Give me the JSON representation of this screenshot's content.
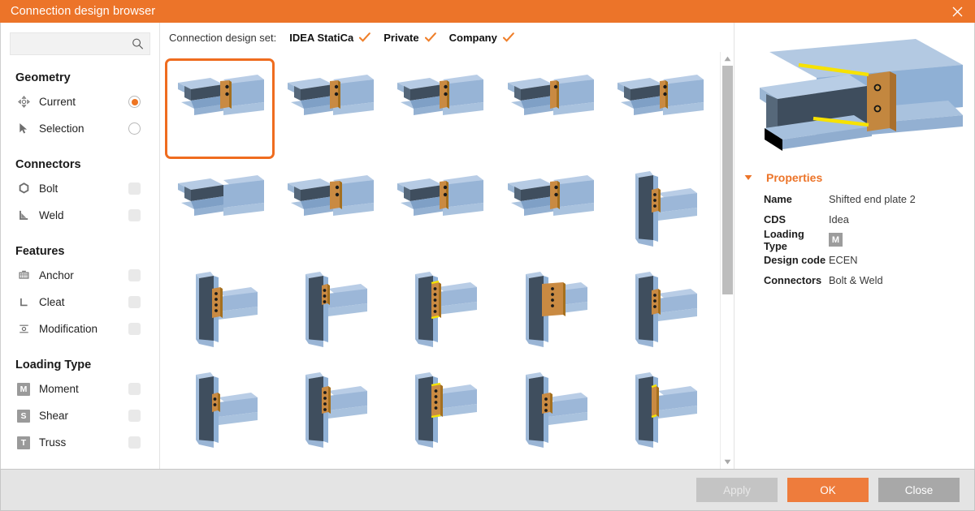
{
  "window": {
    "title": "Connection design browser",
    "close_icon": "close-icon"
  },
  "sidebar": {
    "search": {
      "value": "",
      "placeholder": "",
      "icon": "search-icon"
    },
    "groups": [
      {
        "title": "Geometry",
        "items": [
          {
            "icon": "move-gizmo-icon",
            "label": "Current",
            "control": "radio",
            "checked": true
          },
          {
            "icon": "cursor-arrow-icon",
            "label": "Selection",
            "control": "radio",
            "checked": false
          }
        ]
      },
      {
        "title": "Connectors",
        "items": [
          {
            "icon": "bolt-icon",
            "label": "Bolt",
            "control": "checkbox",
            "checked": false
          },
          {
            "icon": "weld-icon",
            "label": "Weld",
            "control": "checkbox",
            "checked": false
          }
        ]
      },
      {
        "title": "Features",
        "items": [
          {
            "icon": "anchor-icon",
            "label": "Anchor",
            "control": "checkbox",
            "checked": false
          },
          {
            "icon": "cleat-icon",
            "label": "Cleat",
            "control": "checkbox",
            "checked": false
          },
          {
            "icon": "modification-icon",
            "label": "Modification",
            "control": "checkbox",
            "checked": false
          }
        ]
      },
      {
        "title": "Loading Type",
        "items": [
          {
            "icon": "moment-badge-icon",
            "badge": "M",
            "label": "Moment",
            "control": "checkbox",
            "checked": false
          },
          {
            "icon": "shear-badge-icon",
            "badge": "S",
            "label": "Shear",
            "control": "checkbox",
            "checked": false
          },
          {
            "icon": "truss-badge-icon",
            "badge": "T",
            "label": "Truss",
            "control": "checkbox",
            "checked": false
          }
        ]
      }
    ]
  },
  "design_set": {
    "label": "Connection design set:",
    "options": [
      {
        "name": "IDEA StatiCa",
        "checked": true
      },
      {
        "name": "Private",
        "checked": true
      },
      {
        "name": "Company",
        "checked": true
      }
    ]
  },
  "grid": {
    "selected_index": 0,
    "items": [
      {
        "type": "beam-to-beam-shifted-endplate",
        "selected": true
      },
      {
        "type": "beam-to-beam-endplate-bolted"
      },
      {
        "type": "beam-to-beam-endplate"
      },
      {
        "type": "beam-to-beam-fin-plate"
      },
      {
        "type": "beam-to-beam-weld"
      },
      {
        "type": "beam-to-beam-plain"
      },
      {
        "type": "beam-to-beam-bolted-plate"
      },
      {
        "type": "beam-to-beam-short-plate"
      },
      {
        "type": "beam-to-beam-full-endplate"
      },
      {
        "type": "column-beam-web-plate"
      },
      {
        "type": "column-beam-endplate-1"
      },
      {
        "type": "column-beam-endplate-2"
      },
      {
        "type": "column-beam-haunch"
      },
      {
        "type": "column-beam-wide-plate"
      },
      {
        "type": "column-beam-stiffened"
      },
      {
        "type": "column-beam-fin-1"
      },
      {
        "type": "column-beam-fin-2"
      },
      {
        "type": "column-beam-angle-cleat"
      },
      {
        "type": "column-beam-bolted-cleat"
      },
      {
        "type": "column-beam-welded"
      }
    ]
  },
  "scrollbar": {
    "up_icon": "chevron-up-icon",
    "down_icon": "chevron-down-icon"
  },
  "preview": {
    "model": "shifted-end-plate-connection-3d"
  },
  "properties": {
    "title": "Properties",
    "expanded": true,
    "toggle_icon": "triangle-down-icon",
    "rows": [
      {
        "key": "Name",
        "value": "Shifted end plate 2"
      },
      {
        "key": "CDS",
        "value": "Idea"
      },
      {
        "key": "Loading Type",
        "value": "M",
        "badge": true
      },
      {
        "key": "Design code",
        "value": "ECEN"
      },
      {
        "key": "Connectors",
        "value": "Bolt & Weld"
      }
    ]
  },
  "footer": {
    "apply": "Apply",
    "ok": "OK",
    "close": "Close"
  },
  "colors": {
    "accent": "#ec7429",
    "ok_button": "#ee7c3c",
    "steel_light": "#9db9d9",
    "steel_mid": "#8aaed3",
    "steel_dark": "#3f4e5e",
    "plate": "#c98a42",
    "weld": "#f5e400"
  }
}
